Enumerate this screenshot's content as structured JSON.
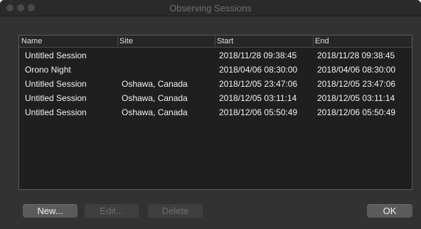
{
  "window": {
    "title": "Observing Sessions"
  },
  "table": {
    "headers": {
      "name": "Name",
      "site": "Site",
      "start": "Start",
      "end": "End"
    },
    "rows": [
      {
        "name": "Untitled Session",
        "site": "",
        "start": "2018/11/28 09:38:45",
        "end": "2018/11/28 09:38:45"
      },
      {
        "name": "Orono Night",
        "site": "",
        "start": "2018/04/06 08:30:00",
        "end": "2018/04/06 08:30:00"
      },
      {
        "name": "Untitled Session",
        "site": "Oshawa, Canada",
        "start": "2018/12/05 23:47:06",
        "end": "2018/12/05 23:47:06"
      },
      {
        "name": "Untitled Session",
        "site": "Oshawa, Canada",
        "start": "2018/12/05 03:11:14",
        "end": "2018/12/05 03:11:14"
      },
      {
        "name": "Untitled Session",
        "site": "Oshawa, Canada",
        "start": "2018/12/06 05:50:49",
        "end": "2018/12/06 05:50:49"
      }
    ]
  },
  "buttons": {
    "new": "New...",
    "edit": "Edit...",
    "delete": "Delete",
    "ok": "OK"
  }
}
